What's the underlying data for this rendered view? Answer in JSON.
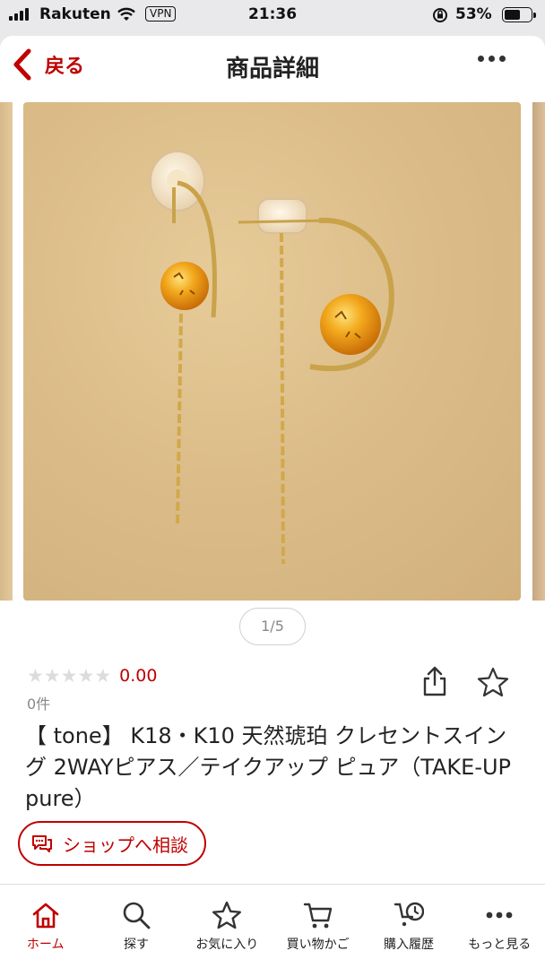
{
  "status_bar": {
    "carrier": "Rakuten",
    "vpn": "VPN",
    "time": "21:36",
    "battery_percent": "53%",
    "battery_level": 0.53
  },
  "nav": {
    "back_label": "戻る",
    "title": "商品詳細"
  },
  "gallery": {
    "pager": "1/5",
    "image_subject": "amber earrings"
  },
  "product": {
    "rating_value": "0.00",
    "star_count": 5,
    "review_count": "0件",
    "title": "【 tone】 K18・K10 天然琥珀  クレセントスイング 2WAYピアス／テイクアップ ピュア（TAKE-UP pure）"
  },
  "consult_button": {
    "label": "ショップへ相談",
    "icon": "chat-bubble-icon"
  },
  "tabbar": {
    "items": [
      {
        "label": "ホーム",
        "icon": "home-icon",
        "active": true
      },
      {
        "label": "探す",
        "icon": "search-icon",
        "active": false
      },
      {
        "label": "お気に入り",
        "icon": "star-icon",
        "active": false
      },
      {
        "label": "買い物かご",
        "icon": "cart-icon",
        "active": false
      },
      {
        "label": "購入履歴",
        "icon": "history-icon",
        "active": false
      },
      {
        "label": "もっと見る",
        "icon": "more-icon",
        "active": false
      }
    ]
  },
  "colors": {
    "accent": "#bf0000",
    "text": "#222222",
    "muted": "#888888"
  }
}
